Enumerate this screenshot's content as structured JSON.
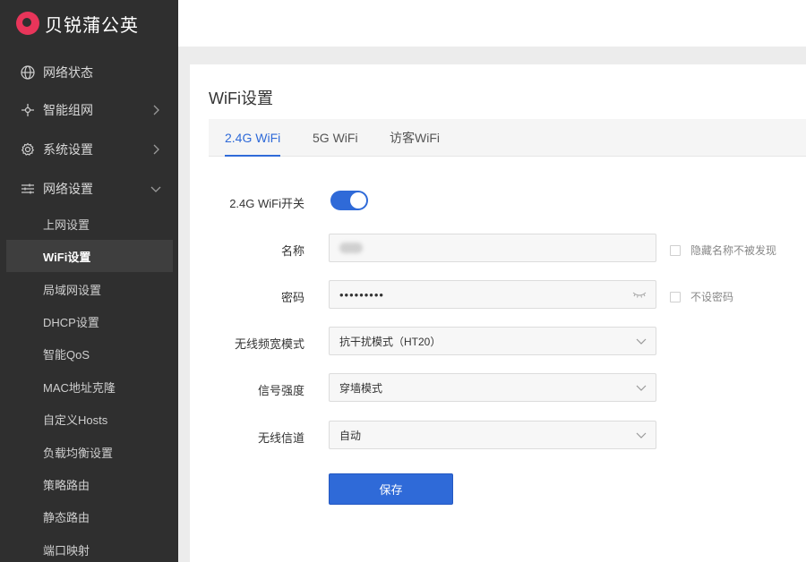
{
  "brand": {
    "name": "贝锐蒲公英"
  },
  "sidebar": {
    "items": [
      {
        "label": "网络状态",
        "icon": "globe-icon"
      },
      {
        "label": "智能组网",
        "icon": "network-icon"
      },
      {
        "label": "系统设置",
        "icon": "gear-icon"
      },
      {
        "label": "网络设置",
        "icon": "sliders-icon",
        "expanded": true
      }
    ],
    "subitems": [
      {
        "label": "上网设置"
      },
      {
        "label": "WiFi设置",
        "active": true
      },
      {
        "label": "局域网设置"
      },
      {
        "label": "DHCP设置"
      },
      {
        "label": "智能QoS"
      },
      {
        "label": "MAC地址克隆"
      },
      {
        "label": "自定义Hosts"
      },
      {
        "label": "负载均衡设置"
      },
      {
        "label": "策略路由"
      },
      {
        "label": "静态路由"
      },
      {
        "label": "端口映射"
      }
    ]
  },
  "page": {
    "title": "WiFi设置",
    "tabs": [
      {
        "label": "2.4G WiFi",
        "active": true
      },
      {
        "label": "5G WiFi"
      },
      {
        "label": "访客WiFi"
      }
    ]
  },
  "form": {
    "switch_label": "2.4G WiFi开关",
    "switch_on": true,
    "name_label": "名称",
    "password_label": "密码",
    "password_value": "•••••••••",
    "hide_name_label": "隐藏名称不被发现",
    "no_password_label": "不设密码",
    "bandwidth_label": "无线频宽模式",
    "bandwidth_value": "抗干扰模式（HT20）",
    "signal_label": "信号强度",
    "signal_value": "穿墙模式",
    "channel_label": "无线信道",
    "channel_value": "自动",
    "save_label": "保存"
  },
  "colors": {
    "accent": "#2f6ad8",
    "sidebar_bg": "#2f2f2f",
    "brand": "#e8355a"
  }
}
